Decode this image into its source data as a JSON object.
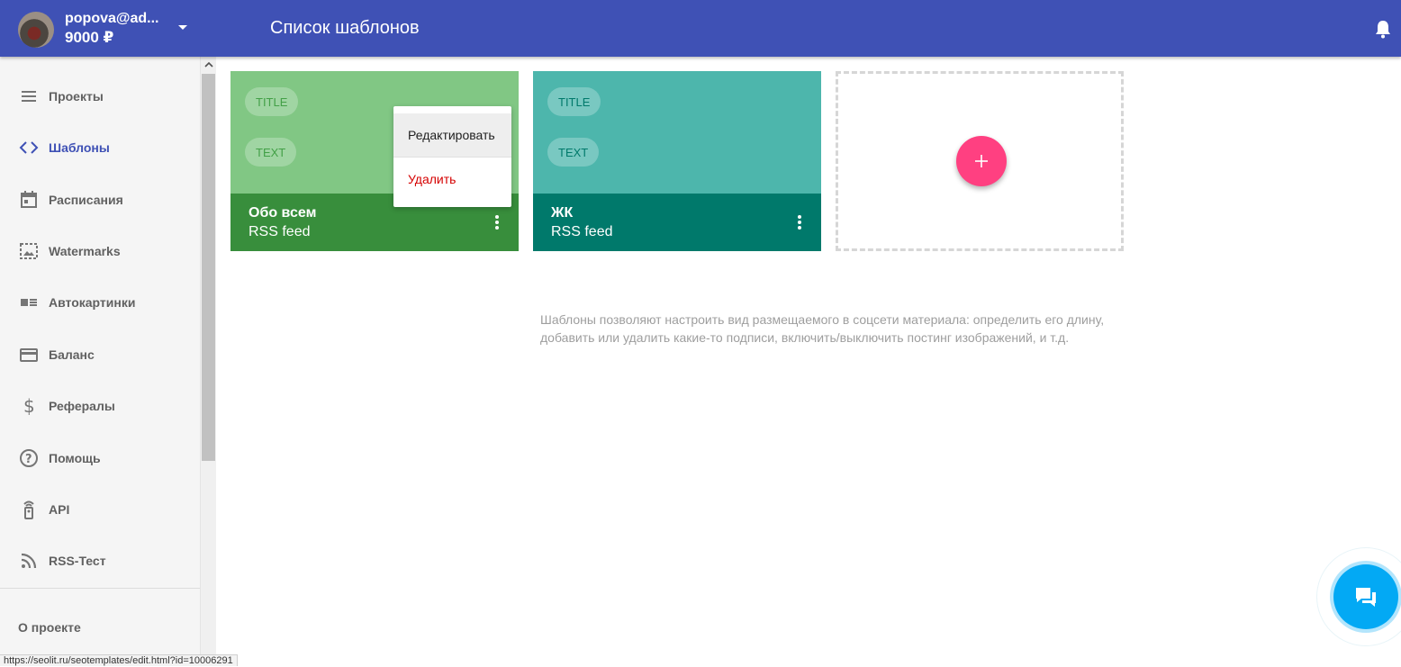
{
  "header": {
    "user_email": "popova@ad...",
    "balance": "9000 ₽",
    "page_title": "Список шаблонов",
    "color": "#3f51b5"
  },
  "sidebar": {
    "items": [
      {
        "label": "Проекты",
        "icon": "list-icon",
        "active": false
      },
      {
        "label": "Шаблоны",
        "icon": "code-icon",
        "active": true
      },
      {
        "label": "Расписания",
        "icon": "calendar-icon",
        "active": false
      },
      {
        "label": "Watermarks",
        "icon": "image-frame-icon",
        "active": false
      },
      {
        "label": "Автокартинки",
        "icon": "image-list-icon",
        "active": false
      },
      {
        "label": "Баланс",
        "icon": "credit-card-icon",
        "active": false
      },
      {
        "label": "Рефералы",
        "icon": "dollar-icon",
        "active": false
      },
      {
        "label": "Помощь",
        "icon": "help-circle-icon",
        "active": false
      },
      {
        "label": "API",
        "icon": "remote-icon",
        "active": false
      },
      {
        "label": "RSS-Тест",
        "icon": "rss-icon",
        "active": false
      }
    ],
    "about": "О проекте"
  },
  "templates": [
    {
      "name": "Обо всем",
      "source": "RSS feed",
      "chip_title": "TITLE",
      "chip_text": "TEXT",
      "top_color": "#81c784",
      "bottom_color": "#388e3c",
      "chip_text_color": "#43a047"
    },
    {
      "name": "ЖК",
      "source": "RSS feed",
      "chip_title": "TITLE",
      "chip_text": "TEXT",
      "top_color": "#4db6ac",
      "bottom_color": "#00796b",
      "chip_text_color": "#00796b"
    }
  ],
  "context_menu": {
    "edit": "Редактировать",
    "delete": "Удалить"
  },
  "add_button": "+",
  "hint": "Шаблоны позволяют настроить вид размещаемого в соцсети материала: определить его длину, добавить или удалить какие-то подписи, включить/выключить постинг изображений, и т.д.",
  "status_url": "https://seolit.ru/seotemplates/edit.html?id=10006291"
}
